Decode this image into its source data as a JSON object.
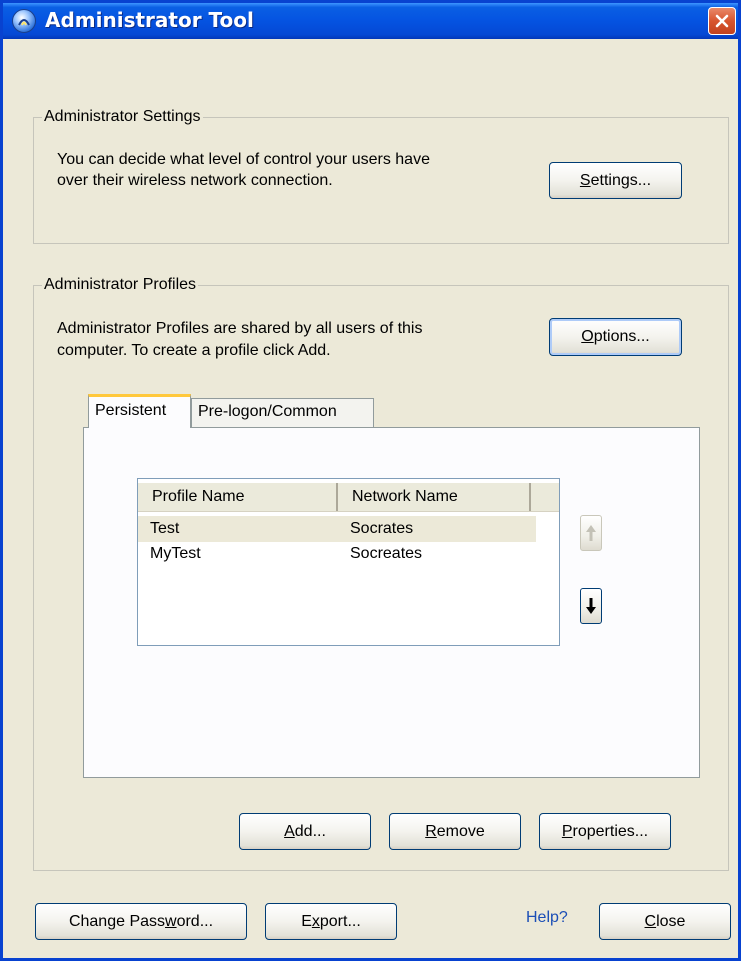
{
  "window": {
    "title": "Administrator Tool"
  },
  "settings_group": {
    "legend": "Administrator Settings",
    "description_line1": "You can decide what level of control your users have",
    "description_line2": "over their wireless network connection.",
    "button": {
      "mnemonic": "S",
      "rest": "ettings..."
    }
  },
  "profiles_group": {
    "legend": "Administrator Profiles",
    "description_line1": "Administrator Profiles are shared by all users of this",
    "description_line2": "computer. To create a profile click Add.",
    "options_button": {
      "mnemonic": "O",
      "rest": "ptions..."
    },
    "tabs": [
      {
        "label": "Persistent",
        "active": true
      },
      {
        "label": "Pre-logon/Common",
        "active": false
      }
    ],
    "table": {
      "columns": [
        "Profile Name",
        "Network Name"
      ],
      "rows": [
        {
          "profile": "Test",
          "network": "Socrates",
          "selected": true
        },
        {
          "profile": "MyTest",
          "network": "Socreates",
          "selected": false
        }
      ]
    },
    "move_up": {
      "icon": "arrow-up-icon",
      "enabled": false
    },
    "move_down": {
      "icon": "arrow-down-icon",
      "enabled": true
    },
    "add_button": {
      "mnemonic": "A",
      "rest": "dd..."
    },
    "remove_button": {
      "mnemonic": "R",
      "rest": "emove"
    },
    "properties_button": {
      "mnemonic": "P",
      "rest": "roperties..."
    }
  },
  "footer": {
    "change_password": {
      "before": "Change Pass",
      "mnemonic": "w",
      "after": "ord..."
    },
    "export": {
      "before": "E",
      "mnemonic": "x",
      "after": "port..."
    },
    "help": "Help?",
    "close": {
      "mnemonic": "C",
      "rest": "lose"
    }
  },
  "colors": {
    "titlebar": "#0553e1",
    "dialog_background": "#ece9d8",
    "close_button": "#d8552f",
    "tab_highlight": "#ffc83c",
    "help_link": "#1b4eb6"
  }
}
